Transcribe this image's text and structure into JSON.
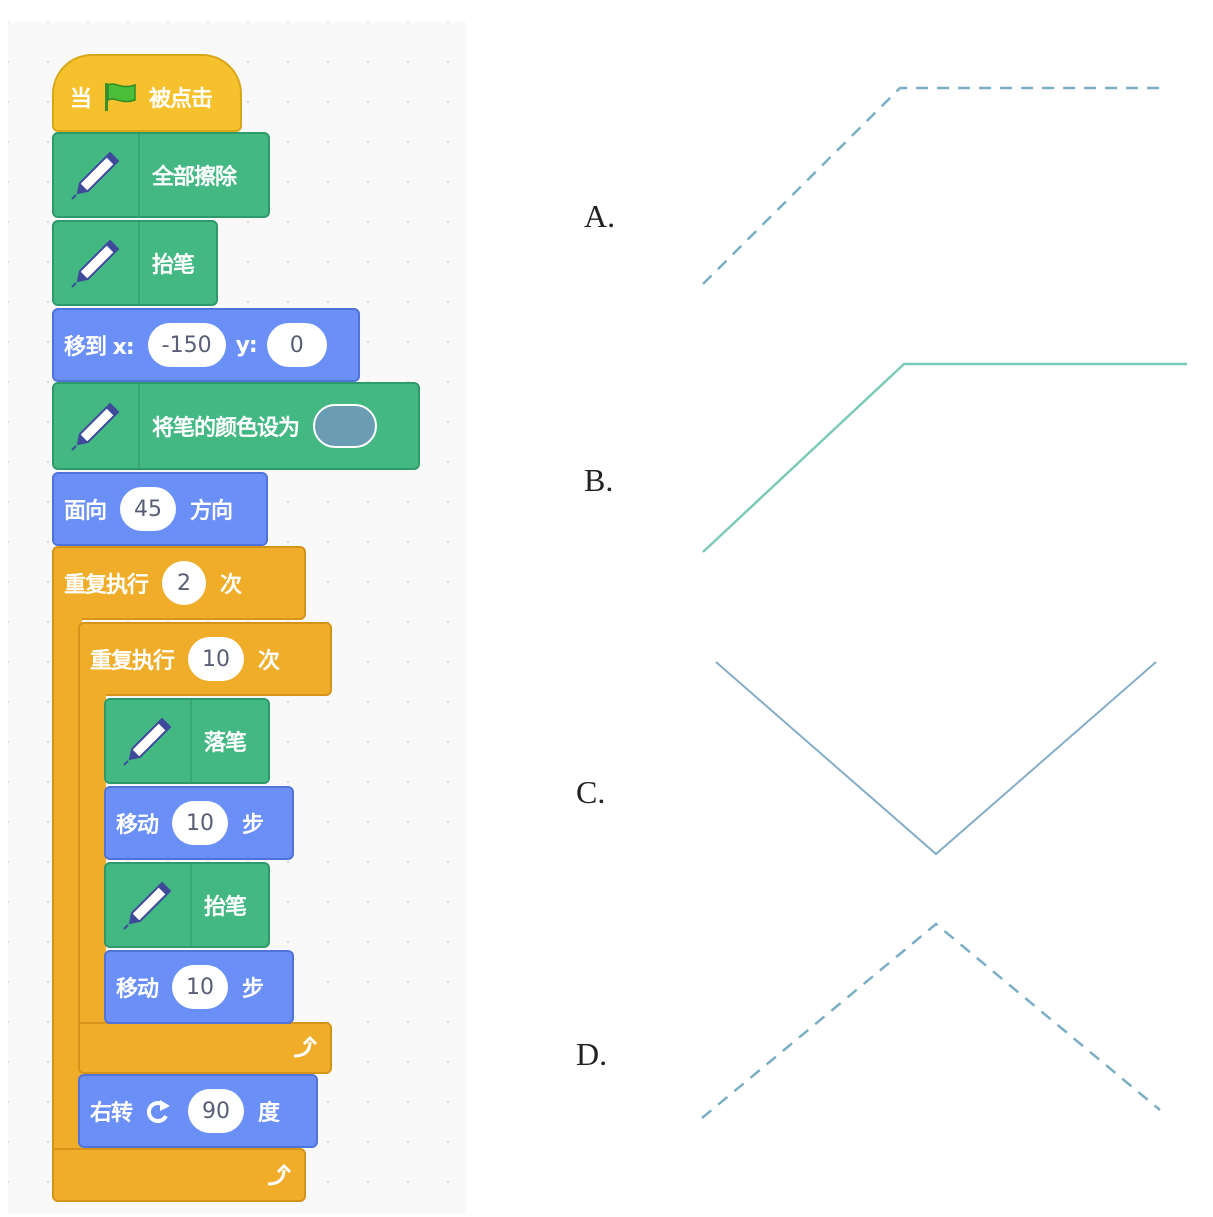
{
  "blocks": {
    "when_flag": {
      "pre": "当",
      "post": "被点击"
    },
    "clear": {
      "label": "全部擦除"
    },
    "pen_up_1": {
      "label": "抬笔"
    },
    "goto": {
      "label": "移到 x:",
      "x": "-150",
      "y_label": "y:",
      "y": "0"
    },
    "set_color": {
      "label": "将笔的颜色设为",
      "color": "#6a9db4"
    },
    "point": {
      "label": "面向",
      "value": "45",
      "post": "方向"
    },
    "repeat_outer": {
      "label": "重复执行",
      "value": "2",
      "post": "次"
    },
    "repeat_inner": {
      "label": "重复执行",
      "value": "10",
      "post": "次"
    },
    "pen_down": {
      "label": "落笔"
    },
    "move_1": {
      "label": "移动",
      "value": "10",
      "post": "步"
    },
    "pen_up_2": {
      "label": "抬笔"
    },
    "move_2": {
      "label": "移动",
      "value": "10",
      "post": "步"
    },
    "turn": {
      "label": "右转",
      "value": "90",
      "post": "度"
    }
  },
  "options": [
    {
      "label": "A.",
      "style": "dashed",
      "color": "#7aaec4"
    },
    {
      "label": "B.",
      "style": "solid",
      "color": "#7ccbb8"
    },
    {
      "label": "C.",
      "style": "solid",
      "color": "#86adc8"
    },
    {
      "label": "D.",
      "style": "dashed",
      "color": "#7aaec4"
    }
  ],
  "colors": {
    "events": "#f5c22e",
    "pen": "#43b883",
    "motion": "#6a8ff6",
    "control": "#efad29"
  },
  "icons": [
    "green-flag-icon",
    "pen-icon",
    "turn-right-icon",
    "loop-arrow-icon"
  ]
}
